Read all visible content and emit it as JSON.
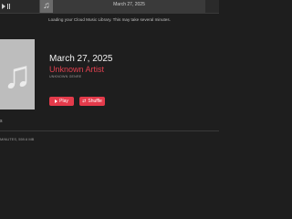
{
  "player": {
    "now_playing_title": "March 27, 2025"
  },
  "banner": {
    "loading_text": "Loading your Cloud Music Library. This may take several minutes."
  },
  "album": {
    "title": "March 27, 2025",
    "artist": "Unknown Artist",
    "genre": "UNKNOWN GENRE",
    "play_label": "Play",
    "shuffle_label": "Shuffle",
    "art_icon": "music-note-icon"
  },
  "section": {
    "label": "s"
  },
  "footer": {
    "text": "MINUTES, 559.6 MB"
  },
  "colors": {
    "accent": "#e43b4b",
    "background": "#1e1e1e",
    "artist_text": "#e0404f"
  }
}
